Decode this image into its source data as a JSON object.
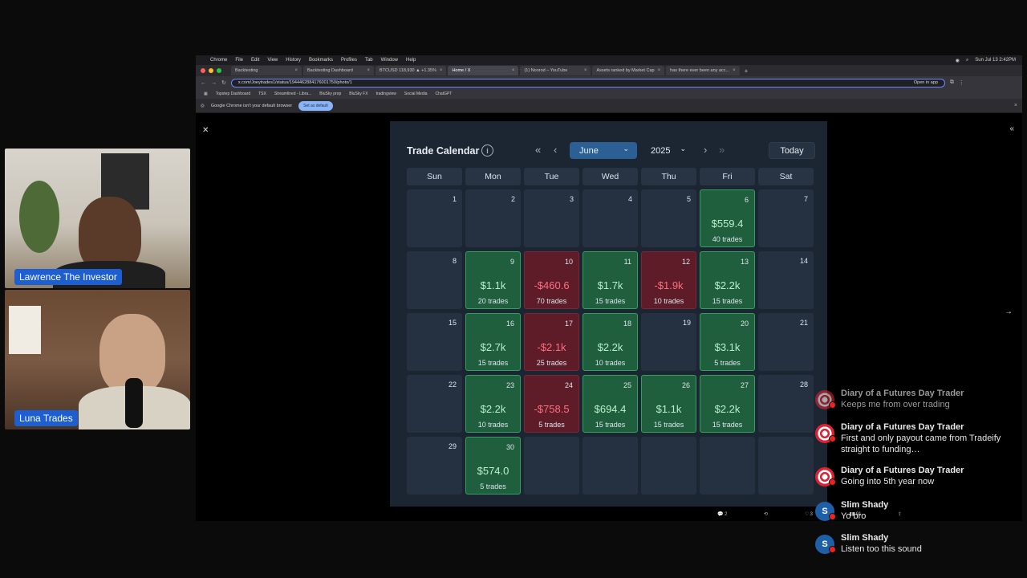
{
  "menubar": {
    "items": [
      "Chrome",
      "File",
      "Edit",
      "View",
      "History",
      "Bookmarks",
      "Profiles",
      "Tab",
      "Window",
      "Help"
    ],
    "clock": "Sun Jul 13  2:42PM"
  },
  "tabs": [
    {
      "label": "Backtesting"
    },
    {
      "label": "Backtesting Dashboard"
    },
    {
      "label": "BTCUSD 118,930 ▲ +1.35%"
    },
    {
      "label": "Home / X"
    },
    {
      "label": "(1) Noorod – YouTube"
    },
    {
      "label": "Assets ranked by Market Cap"
    },
    {
      "label": "has there ever been any acc..."
    }
  ],
  "address": {
    "url": "x.com/Joeytrades1/status/1944462884176001750/photo/1",
    "open_in_app": "Open in app"
  },
  "bookmarks": [
    "Topstep Dashboard",
    "TSX",
    "Streamlined - Libra...",
    "BluSky prop",
    "BluSky FX",
    "tradingview",
    "Social Media",
    "ChatGPT"
  ],
  "infobar": {
    "text": "Google Chrome isn't your default browser",
    "button": "Set as default"
  },
  "calendar": {
    "title": "Trade Calendar",
    "month": "June",
    "year": "2025",
    "today_label": "Today",
    "weekdays": [
      "Sun",
      "Mon",
      "Tue",
      "Wed",
      "Thu",
      "Fri",
      "Sat"
    ],
    "days": [
      {
        "day": "1",
        "status": "none"
      },
      {
        "day": "2",
        "status": "none"
      },
      {
        "day": "3",
        "status": "none"
      },
      {
        "day": "4",
        "status": "none"
      },
      {
        "day": "5",
        "status": "none"
      },
      {
        "day": "6",
        "status": "win",
        "amount": "$559.4",
        "trades": "40 trades"
      },
      {
        "day": "7",
        "status": "none"
      },
      {
        "day": "8",
        "status": "none"
      },
      {
        "day": "9",
        "status": "win",
        "amount": "$1.1k",
        "trades": "20 trades"
      },
      {
        "day": "10",
        "status": "loss",
        "amount": "-$460.6",
        "trades": "70 trades"
      },
      {
        "day": "11",
        "status": "win",
        "amount": "$1.7k",
        "trades": "15 trades"
      },
      {
        "day": "12",
        "status": "loss",
        "amount": "-$1.9k",
        "trades": "10 trades"
      },
      {
        "day": "13",
        "status": "win",
        "amount": "$2.2k",
        "trades": "15 trades"
      },
      {
        "day": "14",
        "status": "none"
      },
      {
        "day": "15",
        "status": "none"
      },
      {
        "day": "16",
        "status": "win",
        "amount": "$2.7k",
        "trades": "15 trades"
      },
      {
        "day": "17",
        "status": "loss",
        "amount": "-$2.1k",
        "trades": "25 trades"
      },
      {
        "day": "18",
        "status": "win",
        "amount": "$2.2k",
        "trades": "10 trades"
      },
      {
        "day": "19",
        "status": "none"
      },
      {
        "day": "20",
        "status": "win",
        "amount": "$3.1k",
        "trades": "5 trades"
      },
      {
        "day": "21",
        "status": "none"
      },
      {
        "day": "22",
        "status": "none"
      },
      {
        "day": "23",
        "status": "win",
        "amount": "$2.2k",
        "trades": "10 trades"
      },
      {
        "day": "24",
        "status": "loss",
        "amount": "-$758.5",
        "trades": "5 trades"
      },
      {
        "day": "25",
        "status": "win",
        "amount": "$694.4",
        "trades": "15 trades"
      },
      {
        "day": "26",
        "status": "win",
        "amount": "$1.1k",
        "trades": "15 trades"
      },
      {
        "day": "27",
        "status": "win",
        "amount": "$2.2k",
        "trades": "15 trades"
      },
      {
        "day": "28",
        "status": "none"
      },
      {
        "day": "29",
        "status": "none"
      },
      {
        "day": "30",
        "status": "win",
        "amount": "$574.0",
        "trades": "5 trades"
      },
      {
        "day": "",
        "status": "none"
      },
      {
        "day": "",
        "status": "none"
      },
      {
        "day": "",
        "status": "none"
      },
      {
        "day": "",
        "status": "none"
      },
      {
        "day": "",
        "status": "none"
      }
    ]
  },
  "tweet_actions": {
    "replies": "2",
    "retweets": "",
    "likes": "3",
    "views": "91"
  },
  "webcams": [
    {
      "name": "Lawrence The Investor"
    },
    {
      "name": "Luna Trades"
    }
  ],
  "chat": [
    {
      "author": "Diary of a Futures Day Trader",
      "message": "Keeps me from over trading",
      "avatar": "logo",
      "faded": true
    },
    {
      "author": "Diary of a Futures Day Trader",
      "message": "First and only payout came from Tradeify straight to funding…",
      "avatar": "logo",
      "faded": false
    },
    {
      "author": "Diary of a Futures Day Trader",
      "message": "Going into 5th year now",
      "avatar": "logo",
      "faded": false
    },
    {
      "author": "Slim Shady",
      "message": "Yo bro",
      "avatar": "S",
      "faded": false
    },
    {
      "author": "Slim Shady",
      "message": "Listen too this sound",
      "avatar": "S",
      "faded": false
    }
  ],
  "colors": {
    "win": "#1f5f3e",
    "loss": "#5e1b28",
    "accent": "#2c5f93",
    "cam_label": "#1d5fd1"
  }
}
